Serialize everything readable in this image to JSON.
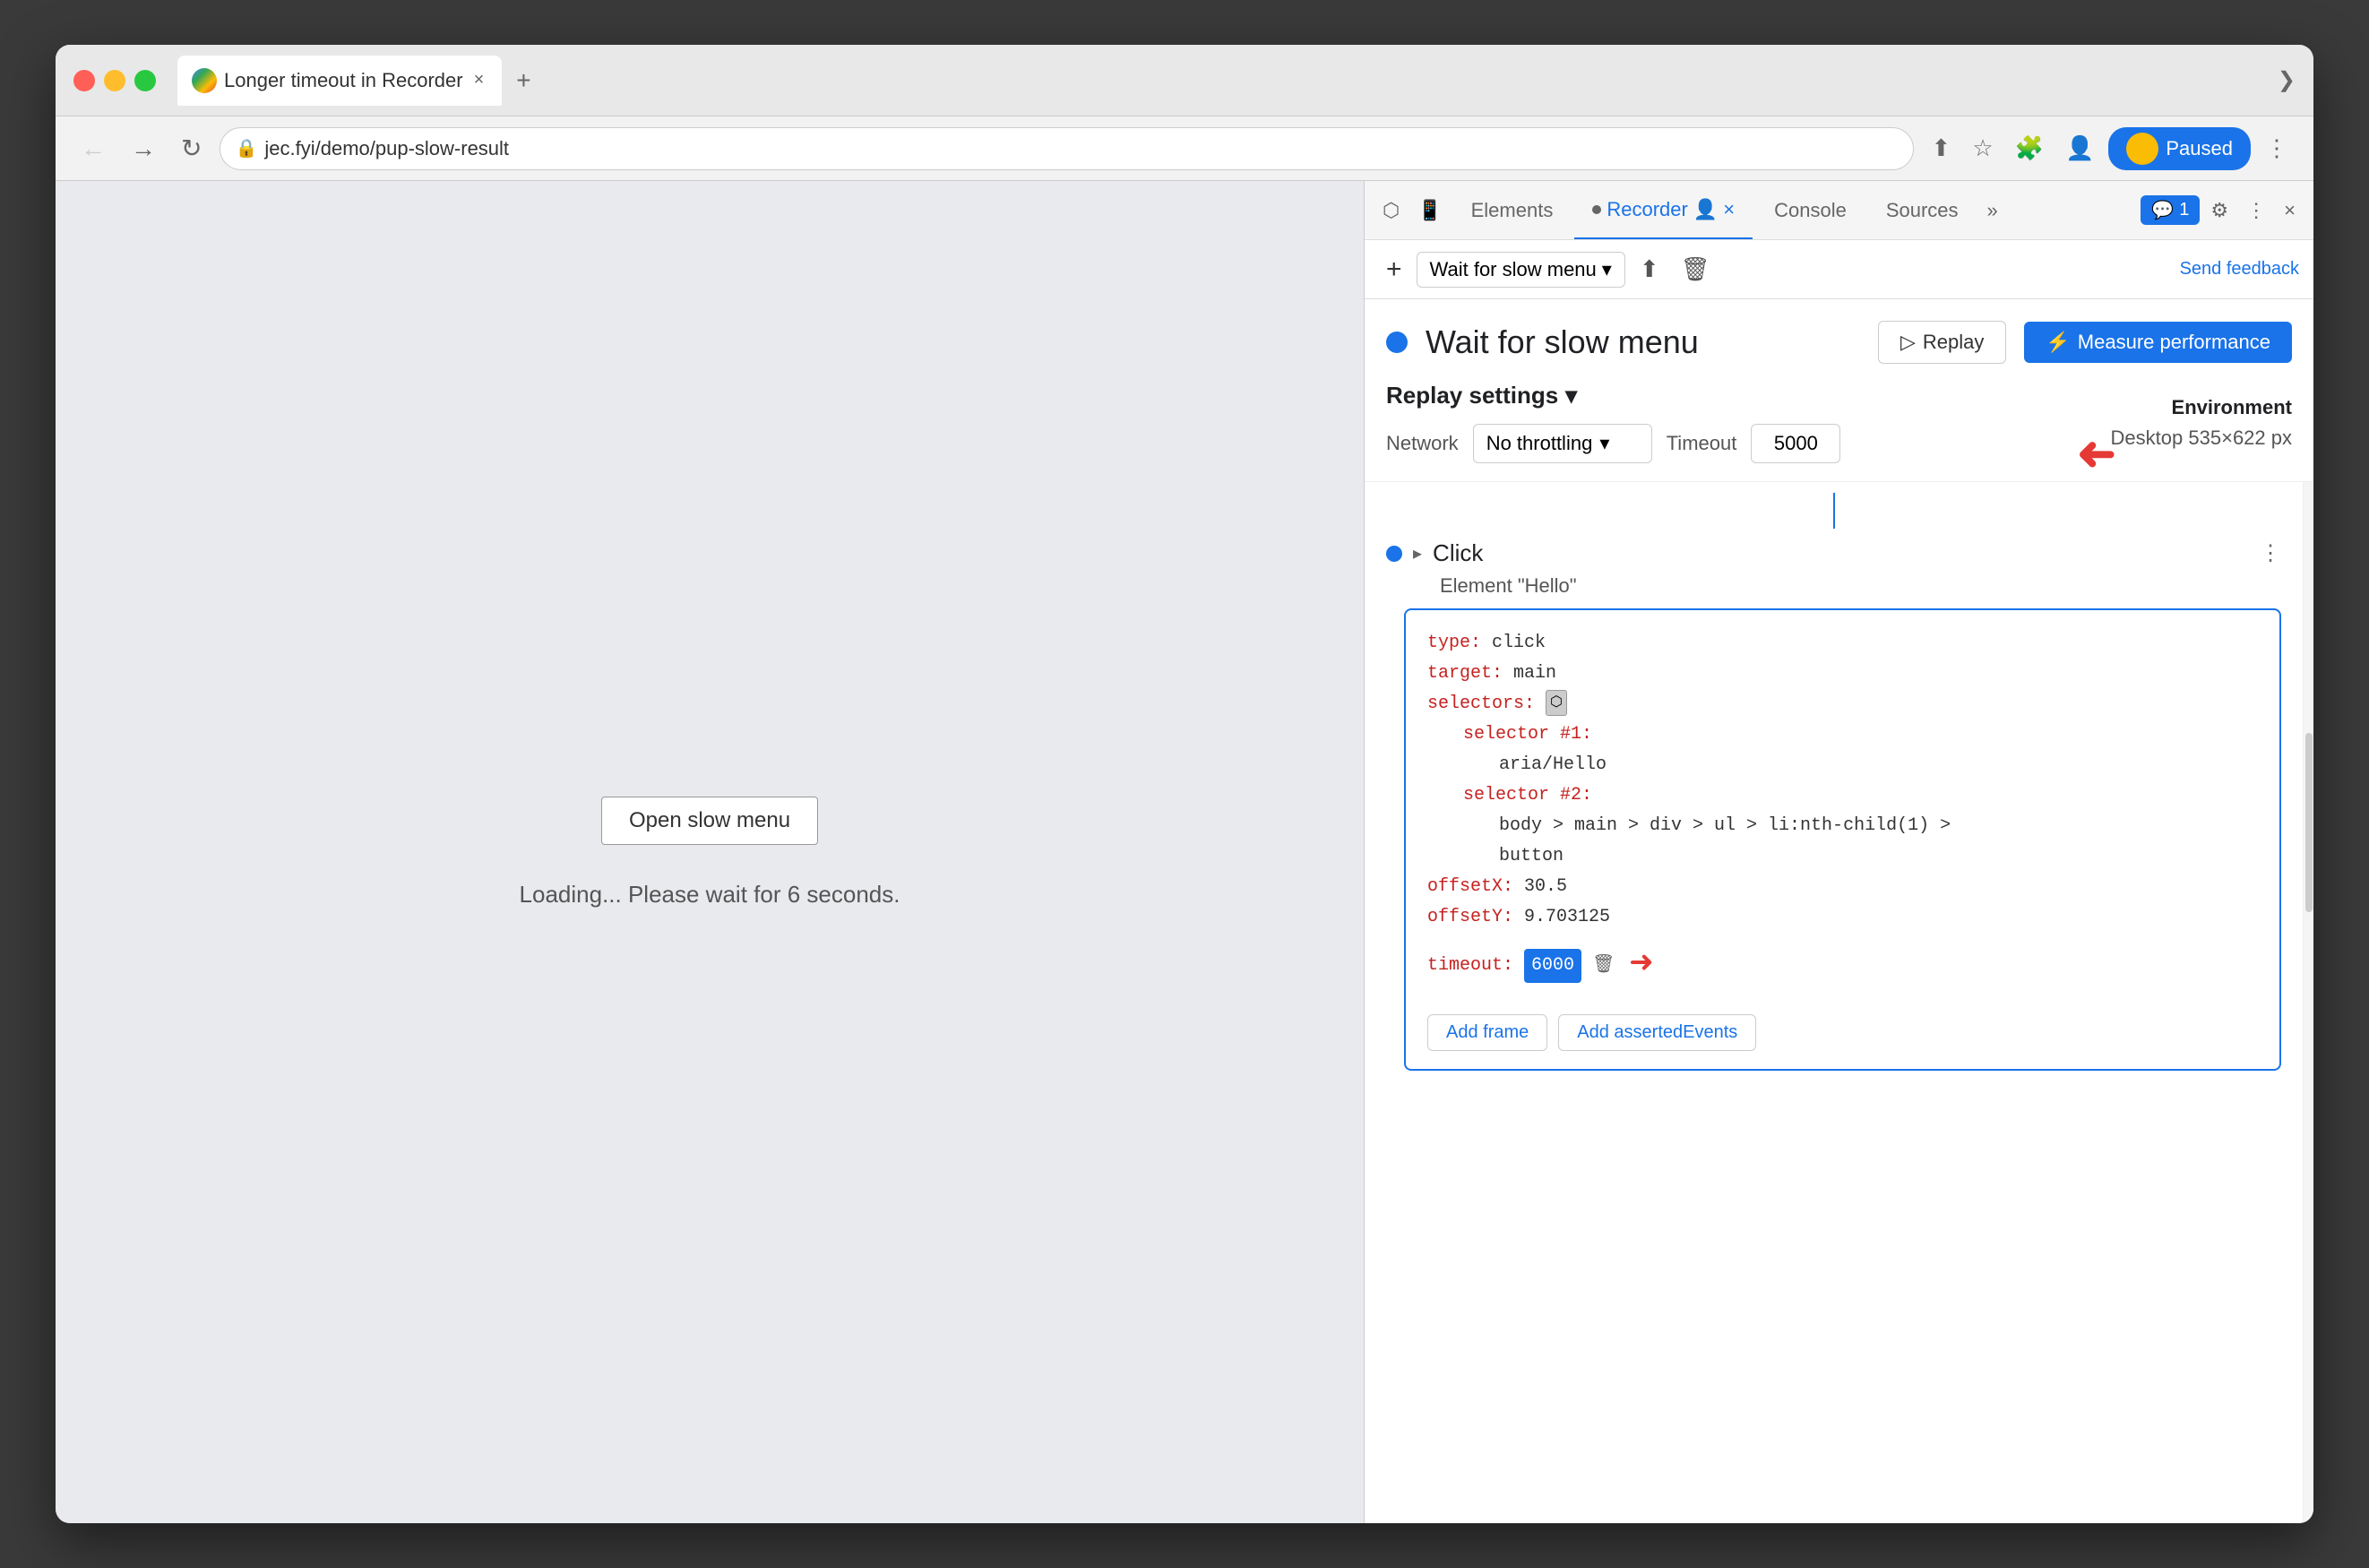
{
  "browser": {
    "tab_title": "Longer timeout in Recorder",
    "tab_close": "×",
    "tab_new": "+",
    "address": "jec.fyi/demo/pup-slow-result",
    "chevron": "❯",
    "paused_label": "Paused"
  },
  "toolbar": {
    "back": "←",
    "forward": "→",
    "reload": "↻",
    "share": "⬆",
    "bookmark": "☆",
    "extensions": "⬛",
    "profile": "👤",
    "more": "⋮"
  },
  "page": {
    "open_slow_menu_btn": "Open slow menu",
    "loading_text": "Loading... Please wait for 6 seconds."
  },
  "devtools": {
    "inspector_icon": "⬡",
    "device_icon": "⬜",
    "tabs": [
      {
        "label": "Elements",
        "active": false
      },
      {
        "label": "Recorder",
        "active": true
      },
      {
        "label": "Console",
        "active": false
      },
      {
        "label": "Sources",
        "active": false
      }
    ],
    "more_tabs": "»",
    "chat_badge": "1",
    "settings_icon": "⚙",
    "more_icon": "⋮",
    "close_icon": "×"
  },
  "recording_toolbar": {
    "add_icon": "+",
    "recording_name": "Wait for slow menu",
    "dropdown_icon": "▾",
    "export_icon": "⬆",
    "delete_icon": "🗑",
    "send_feedback": "Send feedback"
  },
  "recording_header": {
    "title": "Wait for slow menu",
    "replay_label": "Replay",
    "replay_icon": "▷",
    "measure_label": "Measure performance",
    "measure_icon": "⚡"
  },
  "replay_settings": {
    "title": "Replay settings",
    "dropdown_icon": "▾",
    "network_label": "Network",
    "network_value": "No throttling",
    "network_dropdown": "▾",
    "timeout_label": "Timeout",
    "timeout_value": "5000",
    "environment_title": "Environment",
    "environment_value": "Desktop",
    "environment_size": "535×622 px"
  },
  "step": {
    "type": "Click",
    "type_icon": "▸",
    "description": "Element \"Hello\"",
    "more_icon": "⋮",
    "code": {
      "type_key": "type:",
      "type_val": " click",
      "target_key": "target:",
      "target_val": " main",
      "selectors_key": "selectors:",
      "selector1_key": "selector #1:",
      "selector1_val": "aria/Hello",
      "selector2_key": "selector #2:",
      "selector2_val": "body > main > div > ul > li:nth-child(1) >",
      "selector2_val2": "button",
      "offsetX_key": "offsetX:",
      "offsetX_val": " 30.5",
      "offsetY_key": "offsetY:",
      "offsetY_val": " 9.703125",
      "timeout_key": "timeout:",
      "timeout_val": "6000",
      "add_frame_btn": "Add frame",
      "add_asserted_btn": "Add assertedEvents"
    }
  }
}
